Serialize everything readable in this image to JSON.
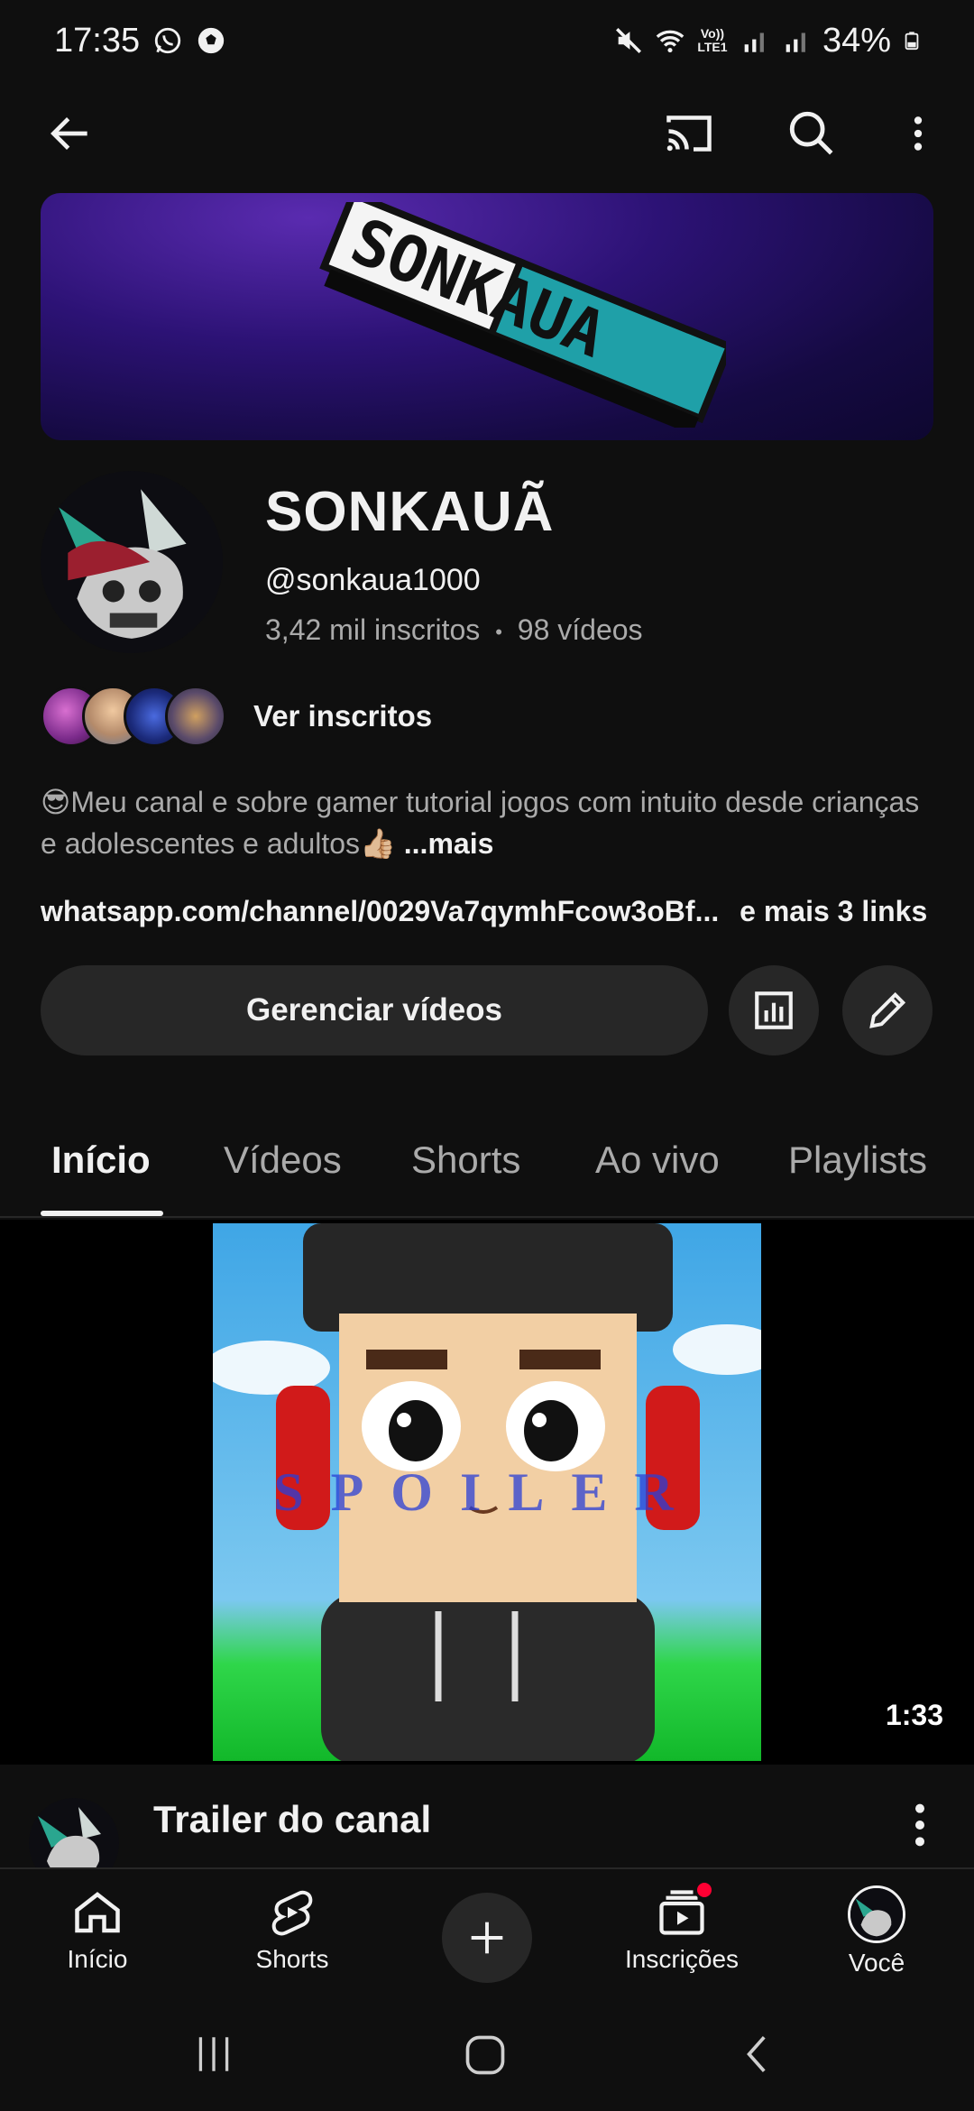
{
  "status_bar": {
    "time": "17:35",
    "battery": "34%",
    "left_icons": [
      "whatsapp-icon",
      "soccer-ball-icon"
    ],
    "right_icons": [
      "mute-icon",
      "wifi-icon",
      "volte-icon",
      "signal-icon",
      "signal-icon",
      "battery-icon"
    ],
    "volte_label": "Vo)) LTE1"
  },
  "appbar": {
    "icons": [
      "back-arrow-icon",
      "cast-icon",
      "search-icon",
      "more-vert-icon"
    ]
  },
  "banner": {
    "logo_text": "SONKAUA"
  },
  "channel": {
    "name": "SONKAUÃ",
    "handle": "@sonkaua1000",
    "subscribers": "3,42 mil inscritos",
    "separator": "•",
    "videos": "98 vídeos",
    "subscribers_link": "Ver inscritos",
    "description": "😎Meu canal e sobre gamer  tutorial jogos com intuito desde crianças e adolescentes e adultos👍🏼",
    "more": "...mais",
    "link": "whatsapp.com/channel/0029Va7qymhFcow3oBf...",
    "more_links": "e mais 3 links",
    "manage_button": "Gerenciar vídeos"
  },
  "tabs": [
    "Início",
    "Vídeos",
    "Shorts",
    "Ao vivo",
    "Playlists"
  ],
  "active_tab": "Início",
  "video": {
    "overlay_text": "SPOILER",
    "duration": "1:33",
    "title": "Trailer do canal"
  },
  "bottom_nav": {
    "home": "Início",
    "shorts": "Shorts",
    "subscriptions": "Inscrições",
    "you": "Você"
  },
  "colors": {
    "background": "#0f0f0f",
    "surface": "#272727",
    "text": "#f1f1f1",
    "secondary_text": "#aaaaaa",
    "notification": "#ff0033"
  }
}
